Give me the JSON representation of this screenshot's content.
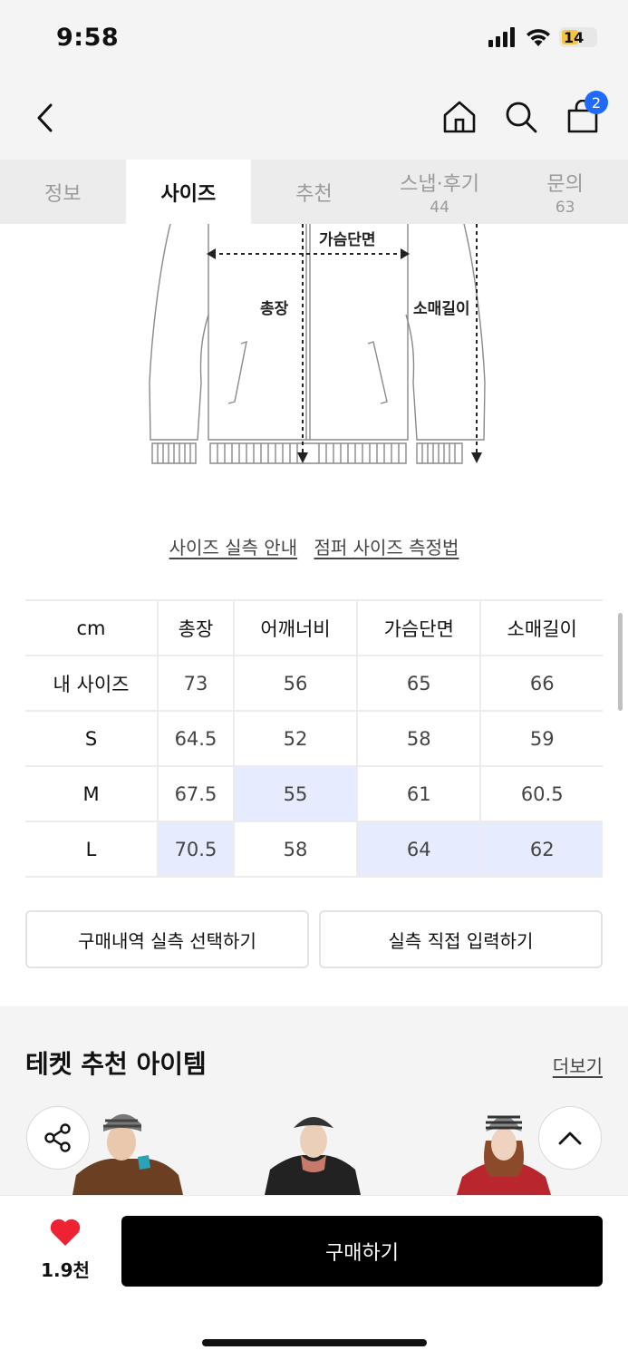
{
  "status": {
    "time": "9:58",
    "battery": "14"
  },
  "header": {
    "cart_count": "2"
  },
  "tabs": [
    {
      "label": "정보",
      "count": ""
    },
    {
      "label": "사이즈",
      "count": ""
    },
    {
      "label": "추천",
      "count": ""
    },
    {
      "label": "스냅·후기",
      "count": "44"
    },
    {
      "label": "문의",
      "count": "63"
    }
  ],
  "diagram": {
    "chest": "가슴단면",
    "length": "총장",
    "sleeve": "소매길이"
  },
  "links": {
    "size_guide": "사이즈 실측 안내",
    "measure_method": "점퍼 사이즈 측정법"
  },
  "size_table": {
    "headers": [
      "cm",
      "총장",
      "어깨너비",
      "가슴단면",
      "소매길이"
    ],
    "rows": [
      {
        "label": "내 사이즈",
        "values": [
          "73",
          "56",
          "65",
          "66"
        ]
      },
      {
        "label": "S",
        "values": [
          "64.5",
          "52",
          "58",
          "59"
        ]
      },
      {
        "label": "M",
        "values": [
          "67.5",
          "55",
          "61",
          "60.5"
        ]
      },
      {
        "label": "L",
        "values": [
          "70.5",
          "58",
          "64",
          "62"
        ]
      }
    ]
  },
  "actions": {
    "select_purchase": "구매내역 실측 선택하기",
    "manual_input": "실측 직접 입력하기"
  },
  "recommend": {
    "title": "테켓 추천 아이템",
    "more": "더보기"
  },
  "bottom": {
    "likes": "1.9천",
    "buy": "구매하기"
  },
  "colors": {
    "accent": "#1f6bff",
    "highlight": "#e6ecfd",
    "heart": "#ee2233",
    "buy": "#000000"
  }
}
